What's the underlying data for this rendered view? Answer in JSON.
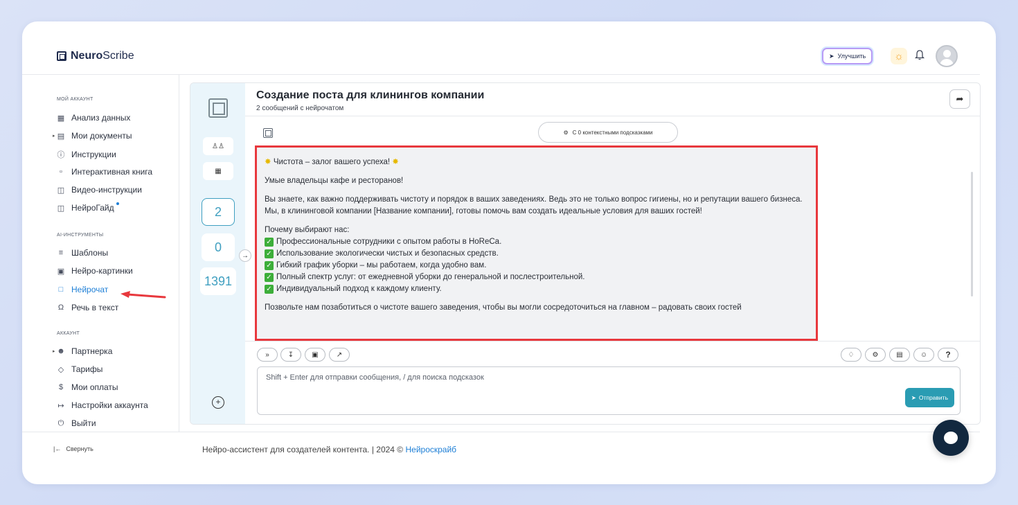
{
  "app": {
    "logo_bold": "Neuro",
    "logo_rest": "Scribe"
  },
  "header": {
    "upgrade_label": "Улучшить"
  },
  "sidebar": {
    "sections": [
      {
        "label": "МОЙ АККАУНТ"
      },
      {
        "label": "AI-ИНСТРУМЕНТЫ"
      },
      {
        "label": "АККАУНТ"
      }
    ],
    "items": [
      {
        "label": "Анализ данных",
        "icon": "grid-icon"
      },
      {
        "label": "Мои документы",
        "icon": "document-icon"
      },
      {
        "label": "Инструкции",
        "icon": "help-circle-icon"
      },
      {
        "label": "Интерактивная книга",
        "icon": "book-icon"
      },
      {
        "label": "Видео-инструкции",
        "icon": "video-icon"
      },
      {
        "label": "НейроГайд",
        "icon": "guide-icon"
      },
      {
        "label": "Шаблоны",
        "icon": "layers-icon"
      },
      {
        "label": "Нейро-картинки",
        "icon": "image-icon"
      },
      {
        "label": "Нейрочат",
        "icon": "chat-icon"
      },
      {
        "label": "Речь в текст",
        "icon": "headphones-icon"
      },
      {
        "label": "Партнерка",
        "icon": "users-icon"
      },
      {
        "label": "Тарифы",
        "icon": "tag-icon"
      },
      {
        "label": "Мои оплаты",
        "icon": "dollar-icon"
      },
      {
        "label": "Настройки аккаунта",
        "icon": "login-icon"
      },
      {
        "label": "Выйти",
        "icon": "power-icon"
      }
    ],
    "collapse_label": "Свернуть"
  },
  "stats": {
    "value1": "2",
    "value2": "0",
    "value3": "1391"
  },
  "chat": {
    "title": "Создание поста для клинингов компании",
    "subtitle": "2 сообщений с нейрочатом",
    "hints_label": "С 0 контекстными подсказками",
    "message": {
      "heading": "Чистота – залог вашего успеха!",
      "greeting": "Умые владельцы кафе и ресторанов!",
      "para1": "Вы знаете, как важно поддерживать чистоту и порядок в ваших заведениях. Ведь это не только вопрос гигиены, но и репутации вашего бизнеса. Мы, в клининговой компании [Название компании], готовы помочь вам создать идеальные условия для ваших гостей!",
      "why_title": "Почему выбирают нас:",
      "bullets": [
        "Профессиональные сотрудники с опытом работы в HoReCa.",
        "Использование экологически чистых и безопасных средств.",
        "Гибкий график уборки – мы работаем, когда удобно вам.",
        "Полный спектр услуг: от ежедневной уборки до генеральной и послестроительной.",
        "Индивидуальный подход к каждому клиенту."
      ],
      "closing": "Позвольте нам позаботиться о чистоте вашего заведения, чтобы вы могли сосредоточиться на главном – радовать своих гостей"
    },
    "input_placeholder": "Shift + Enter для отправки сообщения, / для поиска подсказок",
    "send_label": "Отправить",
    "help_label": "?"
  },
  "footer": {
    "text": "Нейро-ассистент для создателей контента.  | 2024 © ",
    "link": "Нейроскрайб"
  },
  "colors": {
    "accent": "#1e7fd6",
    "send": "#2a9cb3",
    "highlight": "#e8383d",
    "stats_bg": "#eaf5fb"
  }
}
